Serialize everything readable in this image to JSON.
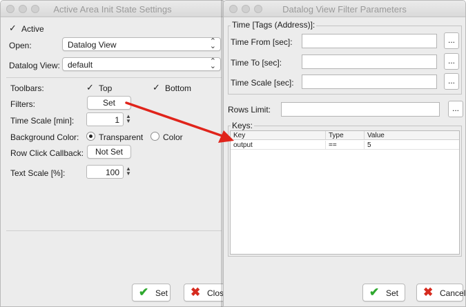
{
  "left_window": {
    "title": "Active Area Init State Settings",
    "active_label": "Active",
    "open_label": "Open:",
    "open_value": "Datalog View",
    "datalog_view_label": "Datalog View:",
    "datalog_view_value": "default",
    "toolbars_label": "Toolbars:",
    "top_label": "Top",
    "bottom_label": "Bottom",
    "filters_label": "Filters:",
    "filters_button": "Set",
    "time_scale_label": "Time Scale [min]:",
    "time_scale_value": "1",
    "background_color_label": "Background Color:",
    "transparent_label": "Transparent",
    "color_label": "Color",
    "row_click_label": "Row Click Callback:",
    "row_click_button": "Not Set",
    "text_scale_label": "Text Scale [%]:",
    "text_scale_value": "100",
    "set_button": "Set",
    "close_button": "Close"
  },
  "right_window": {
    "title": "Datalog View Filter Parameters",
    "time_group_label": "Time [Tags (Address)]:",
    "time_from_label": "Time From [sec]:",
    "time_to_label": "Time To [sec]:",
    "time_scale_label": "Time Scale [sec]:",
    "time_from_value": "",
    "time_to_value": "",
    "time_scale_value": "",
    "dots_label": "...",
    "rows_limit_label": "Rows Limit:",
    "rows_limit_value": "",
    "keys_group_label": "Keys:",
    "keys_table": {
      "columns": [
        "Key",
        "Type",
        "Value"
      ],
      "rows": [
        {
          "key": "output",
          "type": "==",
          "value": "5"
        }
      ]
    },
    "set_button": "Set",
    "cancel_button": "Cancel"
  },
  "colors": {
    "arrow": "#e0241b",
    "ok_check": "#2fa82f",
    "cancel_x": "#d62b1f",
    "title_text": "#9a9a9a"
  }
}
